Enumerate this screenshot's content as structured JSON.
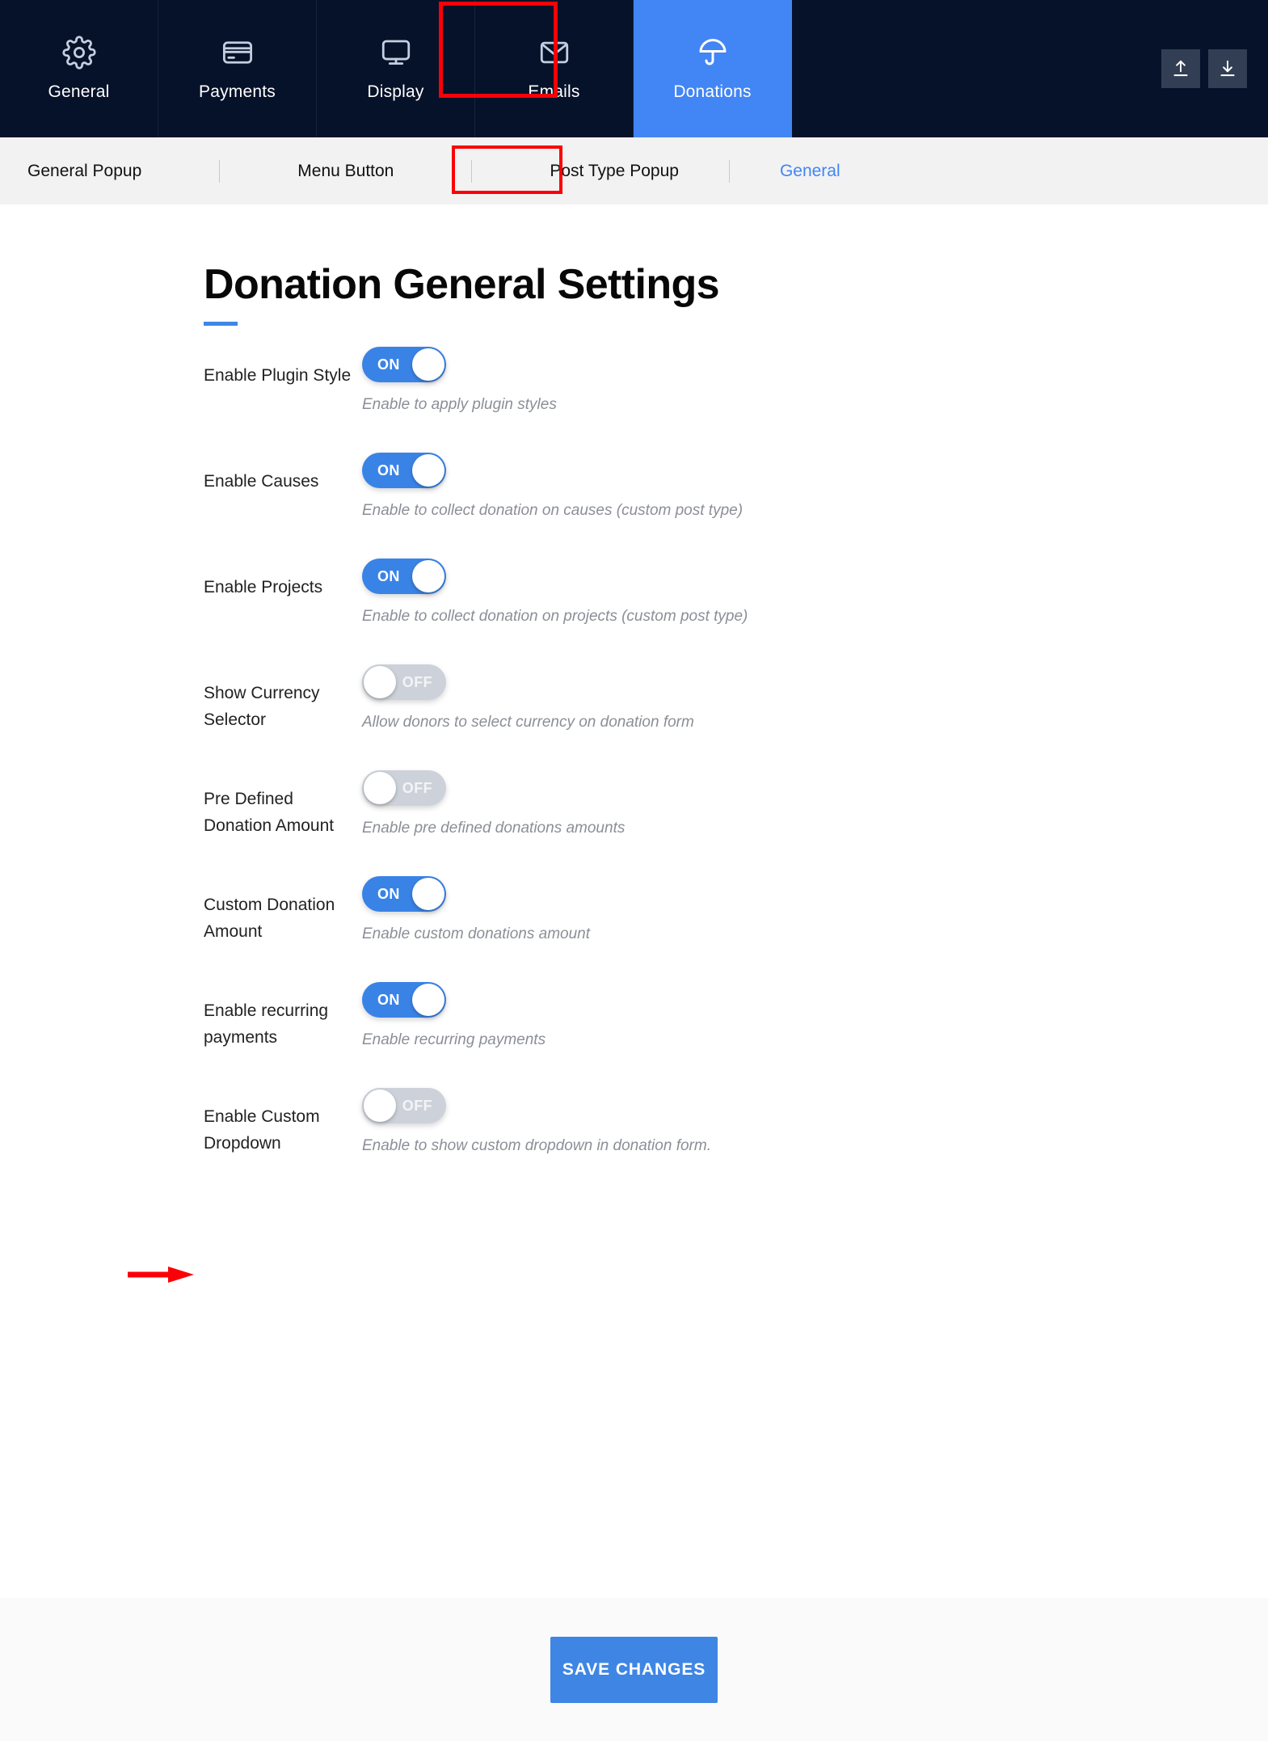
{
  "topnav": {
    "tabs": [
      {
        "label": "General",
        "icon": "gear-icon",
        "active": false
      },
      {
        "label": "Payments",
        "icon": "credit-card-icon",
        "active": false
      },
      {
        "label": "Display",
        "icon": "monitor-icon",
        "active": false
      },
      {
        "label": "Emails",
        "icon": "envelope-icon",
        "active": false
      },
      {
        "label": "Donations",
        "icon": "umbrella-icon",
        "active": true
      }
    ],
    "actions": [
      {
        "name": "import-button",
        "icon": "upload-icon"
      },
      {
        "name": "export-button",
        "icon": "download-icon"
      }
    ],
    "active_tab_color": "#4285f4",
    "background": "#061229"
  },
  "subnav": {
    "tabs": [
      {
        "label": "General Popup",
        "active": false
      },
      {
        "label": "Menu Button",
        "active": false
      },
      {
        "label": "Post Type Popup",
        "active": false
      },
      {
        "label": "General",
        "active": true
      }
    ],
    "active_color": "#4285f4",
    "background": "#f2f2f2"
  },
  "main": {
    "title": "Donation General Settings",
    "accent_color": "#3f86e4",
    "settings": [
      {
        "label": "Enable Plugin Style",
        "state": "ON",
        "on": true,
        "description": "Enable to apply plugin styles"
      },
      {
        "label": "Enable Causes",
        "state": "ON",
        "on": true,
        "description": "Enable to collect donation on causes (custom post type)"
      },
      {
        "label": "Enable Projects",
        "state": "ON",
        "on": true,
        "description": "Enable to collect donation on projects (custom post type)"
      },
      {
        "label": "Show Currency Selector",
        "state": "OFF",
        "on": false,
        "description": "Allow donors to select currency on donation form"
      },
      {
        "label": "Pre Defined Donation Amount",
        "state": "OFF",
        "on": false,
        "description": "Enable pre defined donations amounts"
      },
      {
        "label": "Custom Donation Amount",
        "state": "ON",
        "on": true,
        "description": "Enable custom donations amount"
      },
      {
        "label": "Enable recurring payments",
        "state": "ON",
        "on": true,
        "description": "Enable recurring payments"
      },
      {
        "label": "Enable Custom Dropdown",
        "state": "OFF",
        "on": false,
        "description": "Enable to show custom dropdown in donation form."
      }
    ]
  },
  "footer": {
    "save_label": "SAVE CHANGES",
    "save_color": "#3f86e4"
  },
  "annotations": {
    "color": "#fb0007",
    "highlight_donations_tab": true,
    "highlight_general_subtab": true,
    "arrow_points_to": "Enable recurring payments"
  }
}
